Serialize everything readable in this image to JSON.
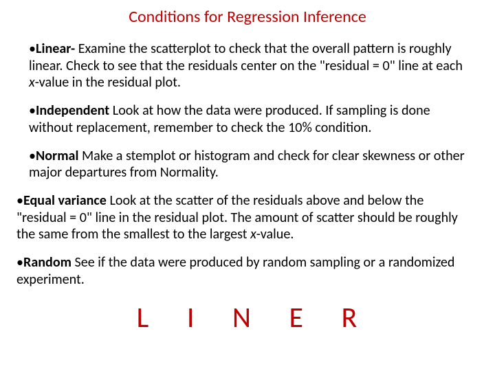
{
  "title": "Conditions for Regression Inference",
  "bullets": [
    {
      "term": "Linear-",
      "text_a": " Examine the scatterplot to check that the overall pattern is roughly linear. Check to see that the residuals center on the \"residual = 0\" line at each ",
      "ital": "x",
      "text_b": "-value in the residual plot."
    },
    {
      "term": "Independent",
      "text_a": " Look at how the data were produced. If sampling is done without replacement, remember to check the 10% condition.",
      "ital": "",
      "text_b": ""
    },
    {
      "term": "Normal",
      "text_a": " Make a stemplot or histogram and check for clear skewness or other major departures from Normality.",
      "ital": "",
      "text_b": ""
    },
    {
      "term": "Equal variance",
      "text_a": " Look at the scatter of the residuals above and below the \"residual = 0\" line in the residual plot. The amount of scatter should be roughly the same from the smallest to the largest ",
      "ital": "x",
      "text_b": "-value."
    },
    {
      "term": "Random",
      "text_a": " See if the data were produced by random sampling or a randomized experiment.",
      "ital": "",
      "text_b": ""
    }
  ],
  "acronym": "L I N E R"
}
